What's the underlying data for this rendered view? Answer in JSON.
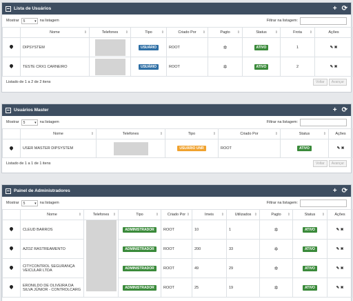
{
  "colors": {
    "header_bg": "#3e4e61",
    "badge_ativo": "#3a8a3a",
    "badge_usuario": "#2e6fa5",
    "badge_usuario_unr": "#f0a22e",
    "badge_administrador": "#3a8a3a"
  },
  "common": {
    "show_label": "Mostrar",
    "per_page": "5",
    "in_list_label": "na listagem",
    "filter_label": "Filtrar na listagem:",
    "prev_button": "Voltar",
    "next_button": "Avançar"
  },
  "usuarios": {
    "title": "Lista de Usuários",
    "columns": [
      "Nome",
      "Telefones",
      "Tipo",
      "Criado Por",
      "Pagto",
      "Status",
      "Frota",
      "Ações"
    ],
    "rows": [
      {
        "nome": "DIPSYSTEM",
        "tipo": "USUÁRIO",
        "criado_por": "ROOT",
        "status": "ATIVO",
        "frota": "1"
      },
      {
        "nome": "TESTE CRX1 CARNEIRO",
        "tipo": "USUÁRIO",
        "criado_por": "ROOT",
        "status": "ATIVO",
        "frota": "2"
      }
    ],
    "info": "Listado de 1 a 2 de 2 itens"
  },
  "master": {
    "title": "Usuários Master",
    "columns": [
      "Nome",
      "Telefones",
      "Tipo",
      "Criado Por",
      "Status",
      "Ações"
    ],
    "rows": [
      {
        "nome": "USER MASTER DIPSYSTEM",
        "tipo": "USUÁRIO UNR",
        "criado_por": "ROOT",
        "status": "ATIVO"
      }
    ],
    "info": "Listado de 1 a 1 de 1 itens"
  },
  "admins": {
    "title": "Painel de Administradores",
    "columns": [
      "Nome",
      "Telefones",
      "Tipo",
      "Criado Por",
      "Imeis",
      "Utilizados",
      "Pagto",
      "Status",
      "Ações"
    ],
    "rows": [
      {
        "nome": "CLEUD BARROS",
        "tipo": "ADMINISTRADOR",
        "criado_por": "ROOT",
        "imeis": "10",
        "utilizados": "1",
        "status": "ATIVO"
      },
      {
        "nome": "AZOZ RASTREAMENTO",
        "tipo": "ADMINISTRADOR",
        "criado_por": "ROOT",
        "imeis": "200",
        "utilizados": "33",
        "status": "ATIVO"
      },
      {
        "nome": "CITYCONTROL SEGURANÇA VEICULAR LTDA",
        "tipo": "ADMINISTRADOR",
        "criado_por": "ROOT",
        "imeis": "49",
        "utilizados": "29",
        "status": "ATIVO"
      },
      {
        "nome": "ERONILDO DE OLIVEIRA DA SILVA JÚNIOR - CONTROLCARG",
        "tipo": "ADMINISTRADOR",
        "criado_por": "ROOT",
        "imeis": "25",
        "utilizados": "19",
        "status": "ATIVO"
      }
    ]
  }
}
